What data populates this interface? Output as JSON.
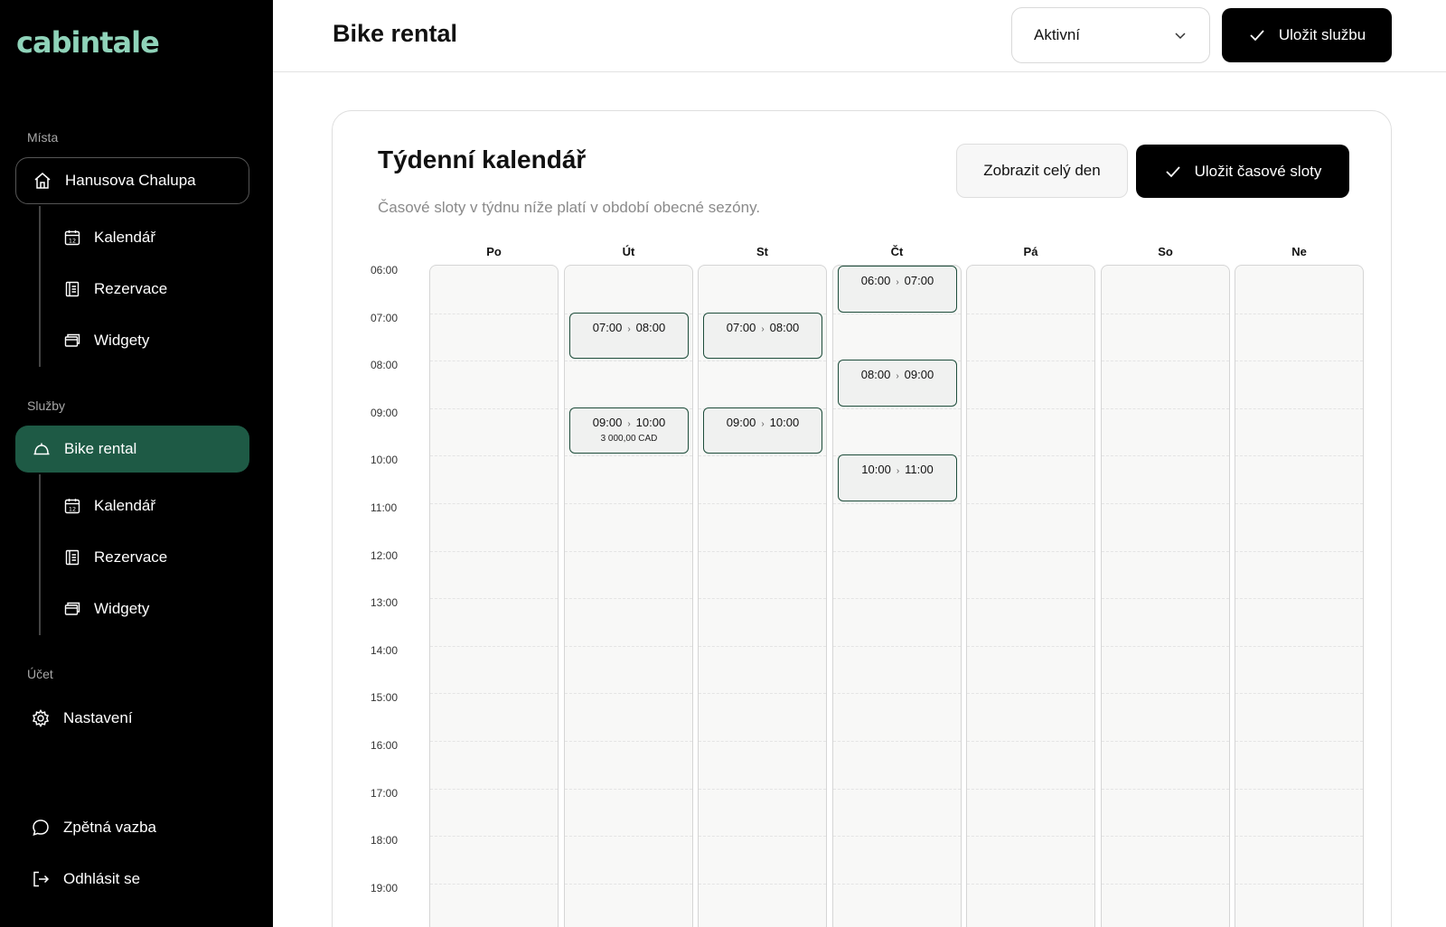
{
  "sidebar": {
    "logo": "cabintale",
    "sections": {
      "places": "Místa",
      "services": "Služby",
      "account": "Účet"
    },
    "place": {
      "name": "Hanusova Chalupa",
      "items": [
        "Kalendář",
        "Rezervace",
        "Widgety"
      ]
    },
    "service": {
      "name": "Bike rental",
      "items": [
        "Kalendář",
        "Rezervace",
        "Widgety"
      ]
    },
    "settings": "Nastavení",
    "feedback": "Zpětná vazba",
    "logout": "Odhlásit se",
    "accent_color": "#1e5a45"
  },
  "header": {
    "title": "Bike rental",
    "status": "Aktivní",
    "save_label": "Uložit službu"
  },
  "calendar": {
    "title": "Týdenní kalendář",
    "subtitle": "Časové sloty v týdnu níže platí v období obecné sezóny.",
    "show_full_day": "Zobrazit celý den",
    "save_slots": "Uložit časové sloty",
    "days": [
      "Po",
      "Út",
      "St",
      "Čt",
      "Pá",
      "So",
      "Ne"
    ],
    "hours": [
      "06:00",
      "07:00",
      "08:00",
      "09:00",
      "10:00",
      "11:00",
      "12:00",
      "13:00",
      "14:00",
      "15:00",
      "16:00",
      "17:00",
      "18:00",
      "19:00"
    ],
    "slots": [
      {
        "day": 1,
        "start": "07:00",
        "end": "08:00",
        "price": ""
      },
      {
        "day": 1,
        "start": "09:00",
        "end": "10:00",
        "price": "3 000,00 CAD"
      },
      {
        "day": 2,
        "start": "07:00",
        "end": "08:00",
        "price": ""
      },
      {
        "day": 2,
        "start": "09:00",
        "end": "10:00",
        "price": ""
      },
      {
        "day": 3,
        "start": "06:00",
        "end": "07:00",
        "price": ""
      },
      {
        "day": 3,
        "start": "08:00",
        "end": "09:00",
        "price": ""
      },
      {
        "day": 3,
        "start": "10:00",
        "end": "11:00",
        "price": ""
      }
    ]
  }
}
